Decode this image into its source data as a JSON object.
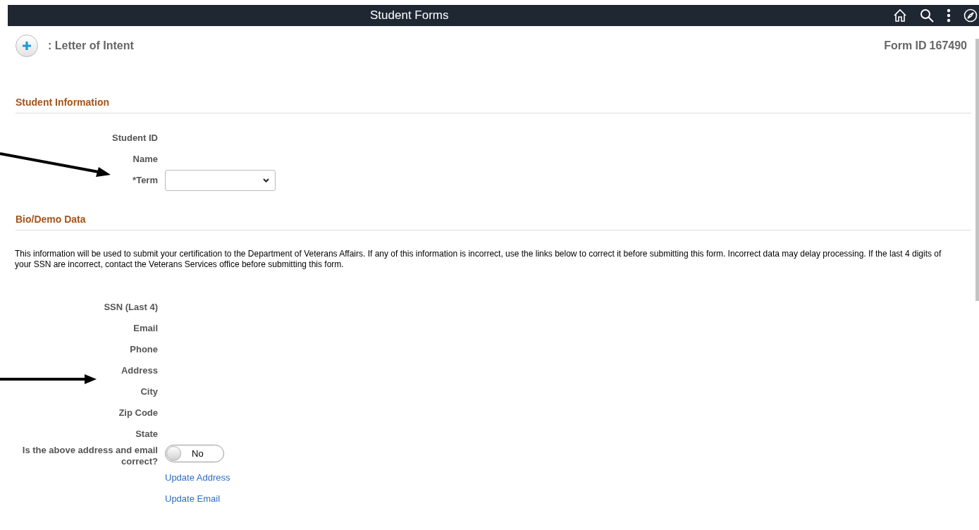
{
  "header": {
    "title": "Student Forms"
  },
  "form": {
    "title": ": Letter of Intent",
    "id_label": "Form ID",
    "id_value": "167490"
  },
  "sections": [
    {
      "title": "Student Information",
      "fields": [
        {
          "kind": "text",
          "label": "Student ID"
        },
        {
          "kind": "text",
          "label": "Name"
        },
        {
          "kind": "select",
          "label": "*Term"
        }
      ]
    },
    {
      "title": "Bio/Demo Data",
      "note": "This information will be used to submit your certification to the Department of Veterans Affairs. If any of this information is incorrect, use the links below to correct it before submitting this form. Incorrect data may delay processing. If the last 4 digits of your SSN are incorrect, contact the Veterans Services office before submitting this form.",
      "fields": [
        {
          "kind": "text",
          "label": "SSN (Last 4)"
        },
        {
          "kind": "text",
          "label": "Email"
        },
        {
          "kind": "text",
          "label": "Phone"
        },
        {
          "kind": "text",
          "label": "Address"
        },
        {
          "kind": "text",
          "label": "City"
        },
        {
          "kind": "text",
          "label": "Zip Code"
        },
        {
          "kind": "text",
          "label": "State"
        },
        {
          "kind": "toggle",
          "label": "Is the above address and email correct?",
          "on": false,
          "value": "No"
        },
        {
          "kind": "link",
          "label": "Update Address"
        },
        {
          "kind": "link",
          "label": "Update Email"
        }
      ]
    }
  ]
}
